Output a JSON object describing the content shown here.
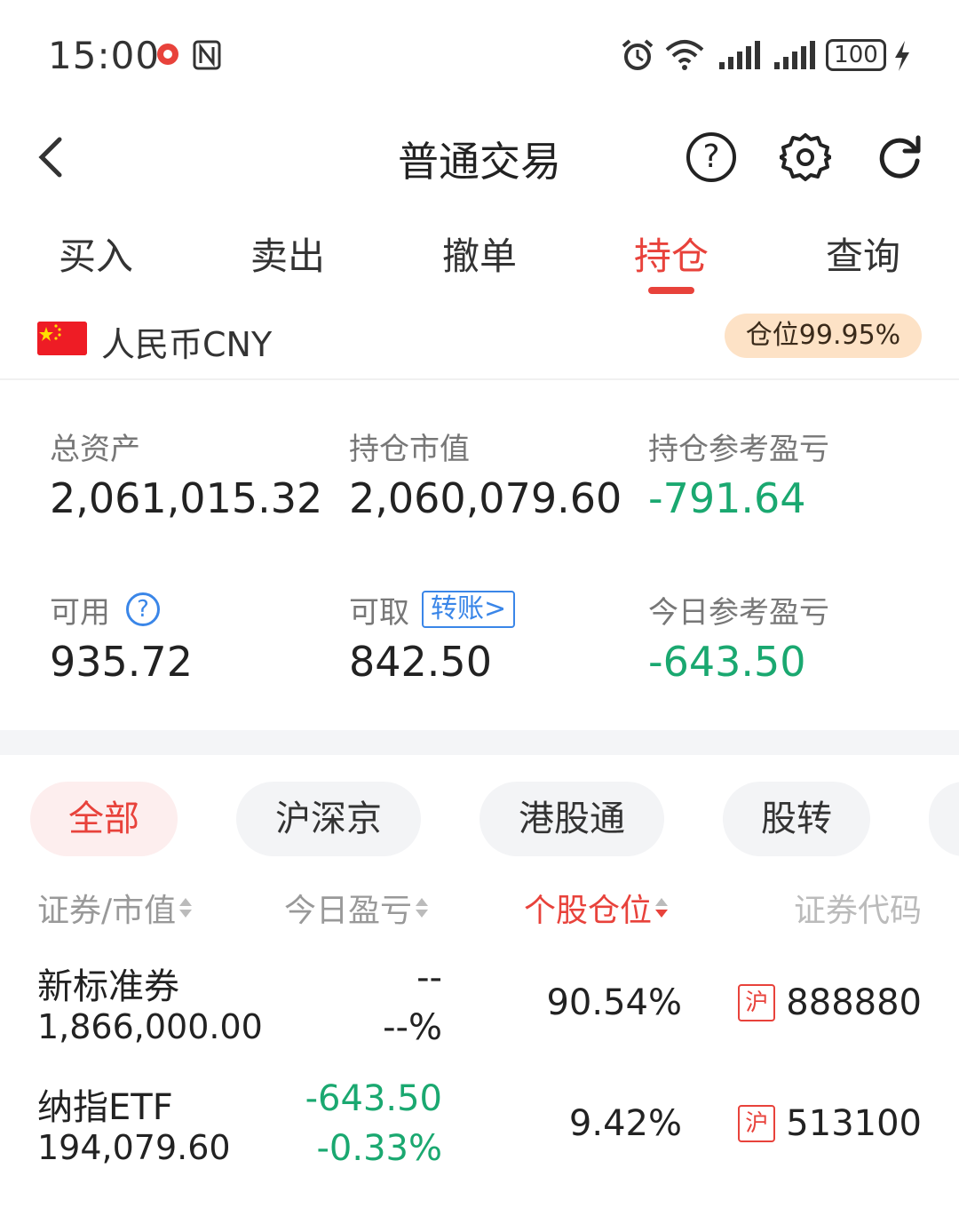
{
  "status_bar": {
    "time": "15:00",
    "battery": "100"
  },
  "nav": {
    "title": "普通交易",
    "help_glyph": "?"
  },
  "tabs": [
    {
      "label": "买入"
    },
    {
      "label": "卖出"
    },
    {
      "label": "撤单"
    },
    {
      "label": "持仓",
      "active": true
    },
    {
      "label": "查询"
    }
  ],
  "currency": {
    "label": "人民币CNY",
    "position_badge": "仓位99.95%"
  },
  "assets": {
    "total_label": "总资产",
    "total_value": "2,061,015.32",
    "market_value_label": "持仓市值",
    "market_value": "2,060,079.60",
    "holding_pl_label": "持仓参考盈亏",
    "holding_pl_value": "-791.64",
    "available_label": "可用",
    "available_value": "935.72",
    "withdrawable_label": "可取",
    "transfer_label": "转账>",
    "withdrawable_value": "842.50",
    "today_pl_label": "今日参考盈亏",
    "today_pl_value": "-643.50"
  },
  "filters": [
    {
      "label": "全部",
      "active": true
    },
    {
      "label": "沪深京"
    },
    {
      "label": "港股通"
    },
    {
      "label": "股转"
    }
  ],
  "columns": {
    "security": "证券/市值",
    "today_pl": "今日盈亏",
    "position": "个股仓位",
    "code": "证券代码"
  },
  "holdings": [
    {
      "name": "新标准券",
      "market_value": "1,866,000.00",
      "today_pl": "--",
      "today_pl_pct": "--%",
      "position": "90.54%",
      "market_tag": "沪",
      "code": "888880"
    },
    {
      "name": "纳指ETF",
      "market_value": "194,079.60",
      "today_pl": "-643.50",
      "today_pl_pct": "-0.33%",
      "position": "9.42%",
      "market_tag": "沪",
      "code": "513100"
    }
  ],
  "colors": {
    "accent_red": "#e8423b",
    "loss_green": "#1aa870",
    "link_blue": "#3a86e8",
    "badge_bg": "#fde2c6"
  }
}
